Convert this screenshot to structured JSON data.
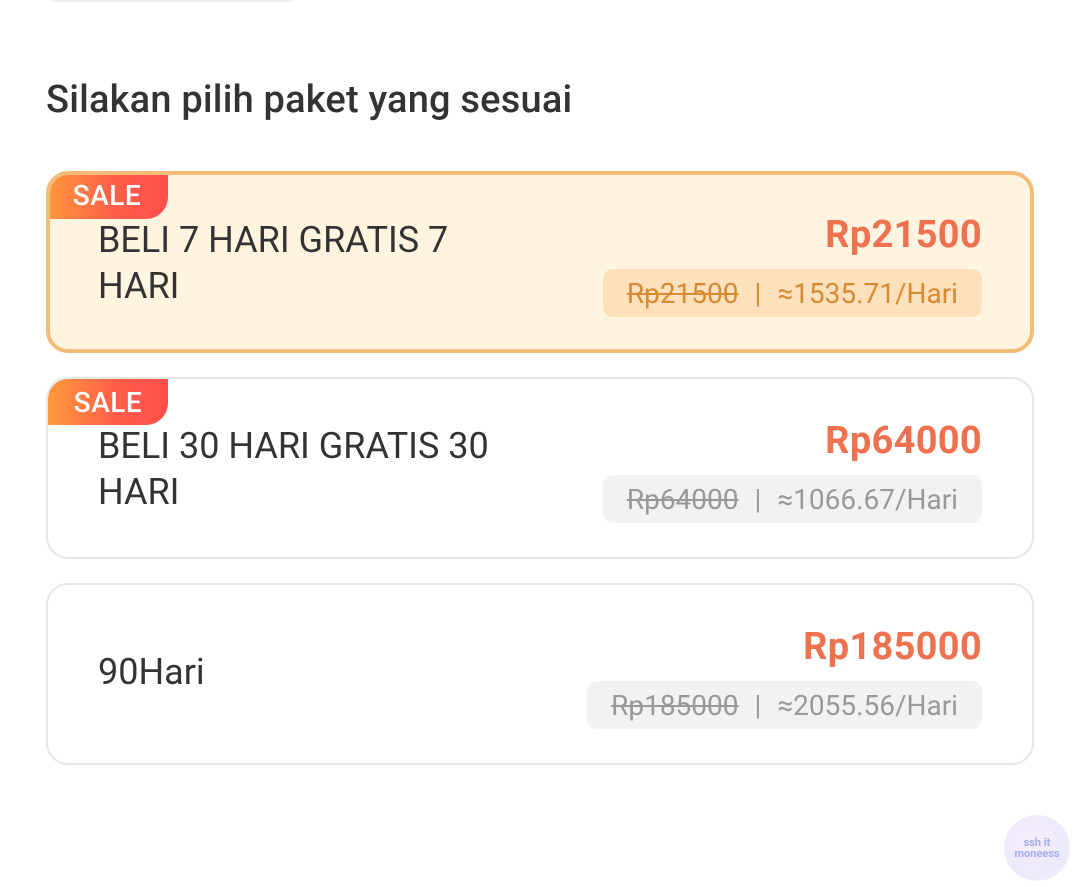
{
  "section_title": "Silakan pilih paket yang sesuai",
  "packages": [
    {
      "badge": "SALE",
      "name": "BELI 7 HARI GRATIS 7 HARI",
      "price": "Rp21500",
      "original_price": "Rp21500",
      "separator": "|",
      "per_day": "≈1535.71/Hari",
      "selected": true
    },
    {
      "badge": "SALE",
      "name": "BELI 30 HARI GRATIS 30 HARI",
      "price": "Rp64000",
      "original_price": "Rp64000",
      "separator": "|",
      "per_day": "≈1066.67/Hari",
      "selected": false
    },
    {
      "name": "90Hari",
      "price": "Rp185000",
      "original_price": "Rp185000",
      "separator": "|",
      "per_day": "≈2055.56/Hari",
      "selected": false
    }
  ],
  "watermark": {
    "text": "ssh it moneess"
  },
  "colors": {
    "price": "#ee7150",
    "selected_border": "#f3bd79",
    "selected_bg": "#fff4df",
    "sale_badge_start": "#ff9a3c",
    "sale_badge_end": "#ff4d4d"
  }
}
